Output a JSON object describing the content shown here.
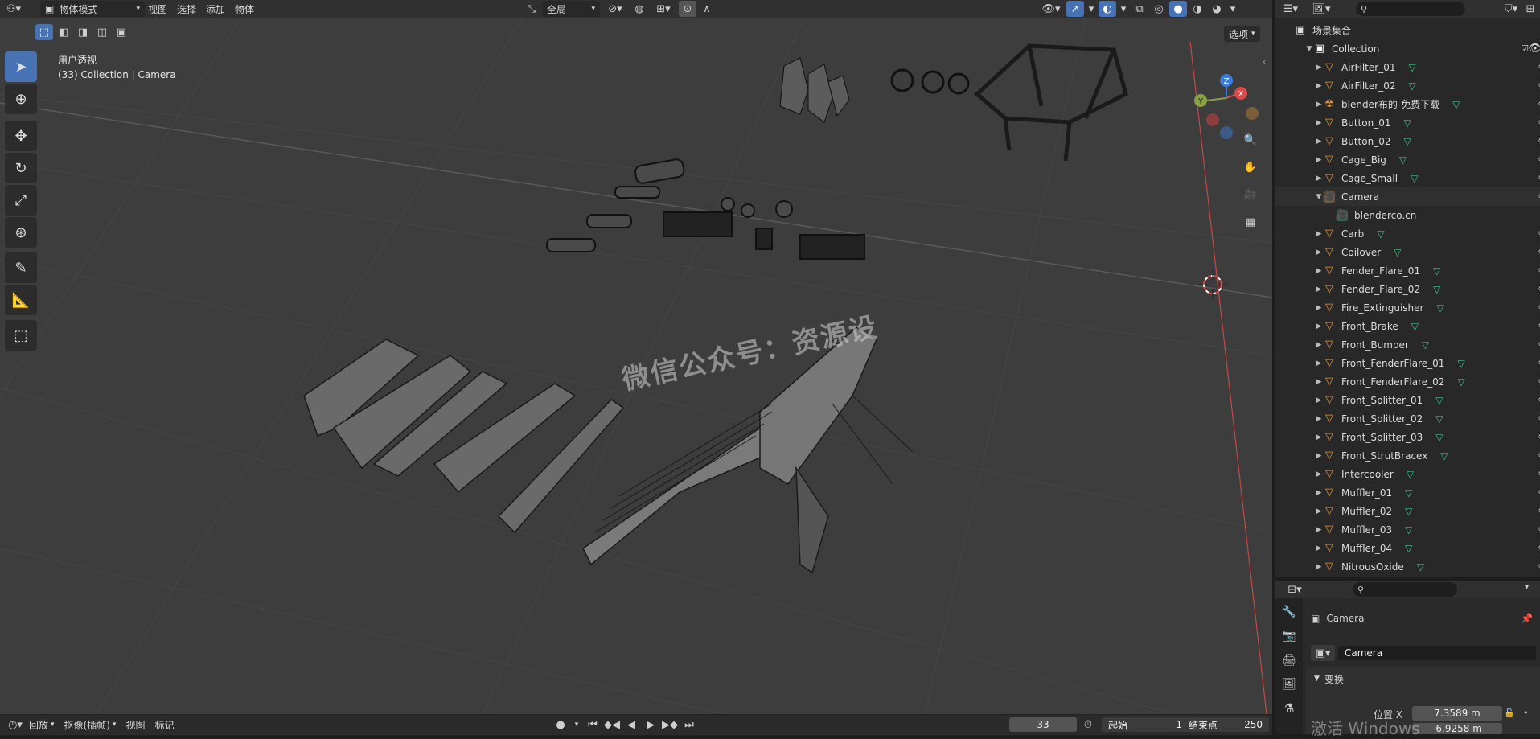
{
  "header": {
    "editor_icon": "editor-type-icon",
    "mode": "物体模式",
    "menus": [
      "视图",
      "选择",
      "添加",
      "物体"
    ],
    "transform_orientation": "全局",
    "options_label": "选项"
  },
  "viewport": {
    "view_name": "用户透视",
    "view_sub": "(33) Collection | Camera",
    "watermark": "微信公众号：资源设",
    "gizmo": {
      "z": "Z",
      "x": "X",
      "y": "Y"
    }
  },
  "tools": [
    "select-box",
    "cursor",
    "move",
    "rotate",
    "scale",
    "transform",
    "annotate",
    "measure",
    "add-cube"
  ],
  "outliner": {
    "scene_collection": "场景集合",
    "collection": "Collection",
    "items": [
      {
        "name": "AirFilter_01",
        "icon": "mesh",
        "depth": 1
      },
      {
        "name": "AirFilter_02",
        "icon": "mesh",
        "depth": 1
      },
      {
        "name": "blender布的-免费下载",
        "icon": "other",
        "depth": 1
      },
      {
        "name": "Button_01",
        "icon": "mesh",
        "depth": 1
      },
      {
        "name": "Button_02",
        "icon": "mesh",
        "depth": 1
      },
      {
        "name": "Cage_Big",
        "icon": "mesh",
        "depth": 1
      },
      {
        "name": "Cage_Small",
        "icon": "mesh",
        "depth": 1
      },
      {
        "name": "Camera",
        "icon": "camera",
        "depth": 1,
        "expanded": true
      },
      {
        "name": "blenderco.cn",
        "icon": "camera-data",
        "depth": 2
      },
      {
        "name": "Carb",
        "icon": "mesh",
        "depth": 1
      },
      {
        "name": "Coilover",
        "icon": "mesh",
        "depth": 1
      },
      {
        "name": "Fender_Flare_01",
        "icon": "mesh",
        "depth": 1
      },
      {
        "name": "Fender_Flare_02",
        "icon": "mesh",
        "depth": 1
      },
      {
        "name": "Fire_Extinguisher",
        "icon": "mesh",
        "depth": 1
      },
      {
        "name": "Front_Brake",
        "icon": "mesh",
        "depth": 1
      },
      {
        "name": "Front_Bumper",
        "icon": "mesh",
        "depth": 1
      },
      {
        "name": "Front_FenderFlare_01",
        "icon": "mesh",
        "depth": 1
      },
      {
        "name": "Front_FenderFlare_02",
        "icon": "mesh",
        "depth": 1
      },
      {
        "name": "Front_Splitter_01",
        "icon": "mesh",
        "depth": 1
      },
      {
        "name": "Front_Splitter_02",
        "icon": "mesh",
        "depth": 1
      },
      {
        "name": "Front_Splitter_03",
        "icon": "mesh",
        "depth": 1
      },
      {
        "name": "Front_StrutBracex",
        "icon": "mesh",
        "depth": 1
      },
      {
        "name": "Intercooler",
        "icon": "mesh",
        "depth": 1
      },
      {
        "name": "Muffler_01",
        "icon": "mesh",
        "depth": 1
      },
      {
        "name": "Muffler_02",
        "icon": "mesh",
        "depth": 1
      },
      {
        "name": "Muffler_03",
        "icon": "mesh",
        "depth": 1
      },
      {
        "name": "Muffler_04",
        "icon": "mesh",
        "depth": 1
      },
      {
        "name": "NitrousOxide",
        "icon": "mesh",
        "depth": 1
      }
    ]
  },
  "properties": {
    "object_name": "Camera",
    "data_name": "Camera",
    "section": "变换",
    "loc_x_label": "位置 X",
    "loc_x": "7.3589 m",
    "loc_y": "-6.9258 m"
  },
  "timeline": {
    "playback": "回放",
    "keying": "抠像(插帧)",
    "view": "视图",
    "marker": "标记",
    "current_frame": "33",
    "start_label": "起始",
    "start": "1",
    "end_label": "结束点",
    "end": "250"
  },
  "os_watermark": "激活 Windows"
}
